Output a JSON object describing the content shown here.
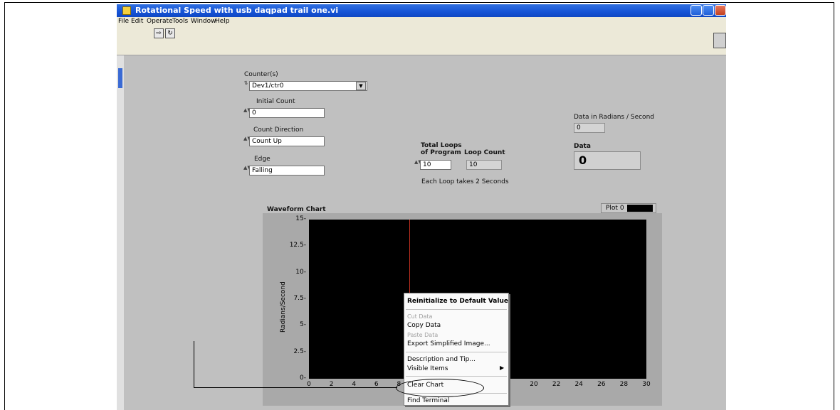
{
  "window": {
    "title": "Rotational Speed with usb daqpad trail one.vi"
  },
  "menu_bar": [
    "File",
    "Edit",
    "Operate",
    "Tools",
    "Window",
    "Help"
  ],
  "toolbar": {
    "run_icon": "run-arrow-icon",
    "run_continuous_icon": "run-continuous-icon",
    "run_glyph": "⇨",
    "continuous_glyph": "↻"
  },
  "controls": {
    "counters_label": "Counter(s)",
    "counters_value": "Dev1/ctr0",
    "initial_count_label": "Initial Count",
    "initial_count_value": "0",
    "count_direction_label": "Count Direction",
    "count_direction_value": "Count Up",
    "edge_label": "Edge",
    "edge_value": "Falling",
    "total_loops_label_1": "Total Loops",
    "total_loops_label_2": "of Program",
    "total_loops_value": "10",
    "loop_count_label": "Loop Count",
    "loop_count_value": "10",
    "loop_note": "Each Loop takes 2 Seconds",
    "radians_label": "Data in Radians / Second",
    "radians_value": "0",
    "data_label": "Data",
    "data_value": "0"
  },
  "chart_data": {
    "type": "line",
    "title": "Waveform Chart",
    "legend": [
      "Plot 0"
    ],
    "ylabel": "Radians/Second",
    "xlabel": "",
    "ylim": [
      0,
      15
    ],
    "xlim": [
      0,
      30
    ],
    "yticks": [
      "15",
      "12.5",
      "10",
      "7.5",
      "5",
      "2.5",
      "0"
    ],
    "xticks": [
      "0",
      "2",
      "4",
      "6",
      "8",
      "20",
      "22",
      "24",
      "26",
      "28",
      "30"
    ],
    "series": [
      {
        "name": "Plot 0",
        "values": []
      }
    ]
  },
  "context_menu": {
    "items": [
      {
        "label": "Reinitialize to Default Value",
        "enabled": true,
        "bold": true
      },
      {
        "label": "Cut Data",
        "enabled": false
      },
      {
        "label": "Copy Data",
        "enabled": true
      },
      {
        "label": "Paste Data",
        "enabled": false
      },
      {
        "label": "Export Simplified Image...",
        "enabled": true
      },
      {
        "label": "Description and Tip...",
        "enabled": true
      },
      {
        "label": "Visible Items",
        "enabled": true,
        "submenu": true
      },
      {
        "label": "Clear Chart",
        "enabled": true
      },
      {
        "label": "Find Terminal",
        "enabled": true
      }
    ]
  }
}
